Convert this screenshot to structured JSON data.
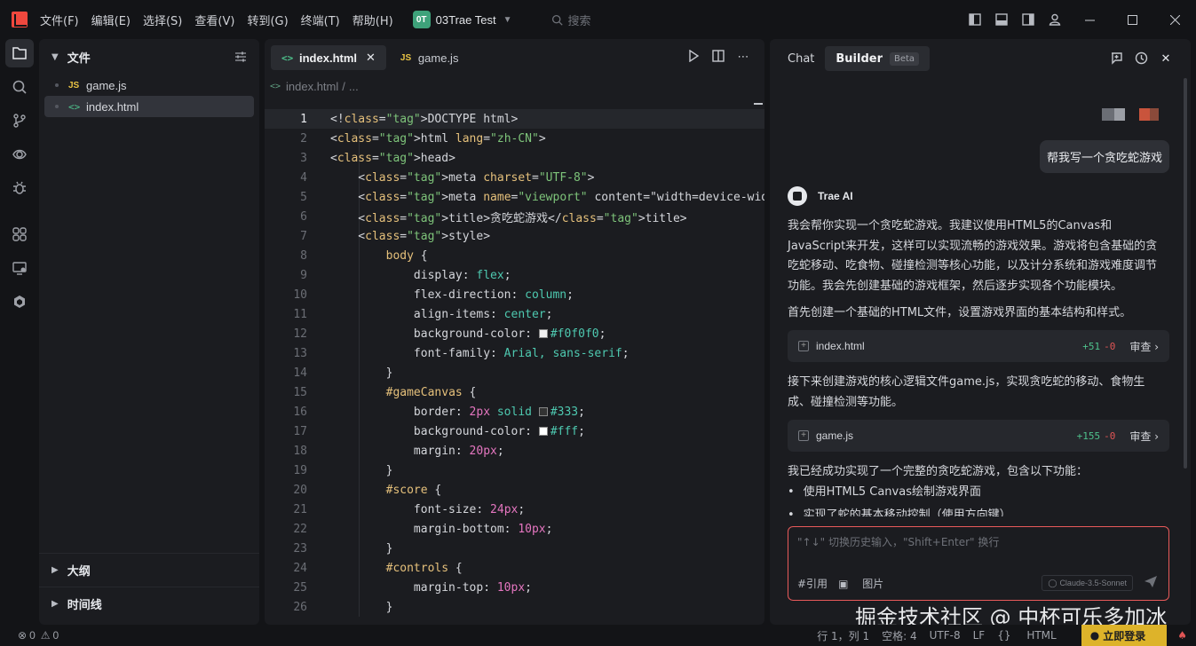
{
  "menu": [
    "文件(F)",
    "编辑(E)",
    "选择(S)",
    "查看(V)",
    "转到(G)",
    "终端(T)",
    "帮助(H)"
  ],
  "project": {
    "badge": "0T",
    "name": "03Trae Test"
  },
  "search_placeholder": "搜索",
  "explorer": {
    "title": "文件",
    "files": [
      {
        "type": "JS",
        "name": "game.js"
      },
      {
        "type": "<>",
        "name": "index.html"
      }
    ],
    "outline": "大纲",
    "timeline": "时间线"
  },
  "editor": {
    "tabs": [
      {
        "icon": "<>",
        "label": "index.html"
      },
      {
        "icon": "JS",
        "label": "game.js"
      }
    ],
    "breadcrumb": {
      "file": "index.html",
      "more": "..."
    },
    "line_numbers": [
      "1",
      "2",
      "3",
      "4",
      "5",
      "6",
      "7",
      "8",
      "9",
      "10",
      "11",
      "12",
      "13",
      "14",
      "15",
      "16",
      "17",
      "18",
      "19",
      "20",
      "21",
      "22",
      "23",
      "24",
      "25",
      "26"
    ],
    "lines": [
      "<!DOCTYPE html>",
      "<html lang=\"zh-CN\">",
      "<head>",
      "    <meta charset=\"UTF-8\">",
      "    <meta name=\"viewport\" content=\"width=device-width, initial-",
      "    <title>贪吃蛇游戏</title>",
      "    <style>",
      "        body {",
      "            display: flex;",
      "            flex-direction: column;",
      "            align-items: center;",
      "            background-color: #f0f0f0;",
      "            font-family: Arial, sans-serif;",
      "        }",
      "        #gameCanvas {",
      "            border: 2px solid #333;",
      "            background-color: #fff;",
      "            margin: 20px;",
      "        }",
      "        #score {",
      "            font-size: 24px;",
      "            margin-bottom: 10px;",
      "        }",
      "        #controls {",
      "            margin-top: 10px;",
      "        }"
    ]
  },
  "chat": {
    "tabs": [
      "Chat",
      "Builder"
    ],
    "beta": "Beta",
    "user_message": "帮我写一个贪吃蛇游戏",
    "assistant_name": "Trae AI",
    "para1": "我会帮你实现一个贪吃蛇游戏。我建议使用HTML5的Canvas和JavaScript来开发，这样可以实现流畅的游戏效果。游戏将包含基础的贪吃蛇移动、吃食物、碰撞检测等核心功能，以及计分系统和游戏难度调节功能。我会先创建基础的游戏框架，然后逐步实现各个功能模块。",
    "para2": "首先创建一个基础的HTML文件，设置游戏界面的基本结构和样式。",
    "card1": {
      "file": "index.html",
      "add": "+51",
      "del": "-0",
      "review": "审查"
    },
    "para3": "接下来创建游戏的核心逻辑文件game.js，实现贪吃蛇的移动、食物生成、碰撞检测等功能。",
    "card2": {
      "file": "game.js",
      "add": "+155",
      "del": "-0",
      "review": "审查"
    },
    "para4": "我已经成功实现了一个完整的贪吃蛇游戏，包含以下功能：",
    "bullets": [
      "使用HTML5 Canvas绘制游戏界面",
      "实现了蛇的基本移动控制（使用方向键）"
    ],
    "input_placeholder": "\"↑↓\" 切换历史输入，\"Shift+Enter\" 换行",
    "quote": "#引用",
    "image": "图片",
    "model": "Claude-3.5-Sonnet"
  },
  "watermark": "掘金技术社区 @ 中杯可乐多加冰",
  "status": {
    "errors": "0",
    "warnings": "0",
    "position": "行 1，列 1",
    "spaces": "空格: 4",
    "encoding": "UTF-8",
    "eol": "LF",
    "language": "HTML",
    "login": "立即登录"
  }
}
